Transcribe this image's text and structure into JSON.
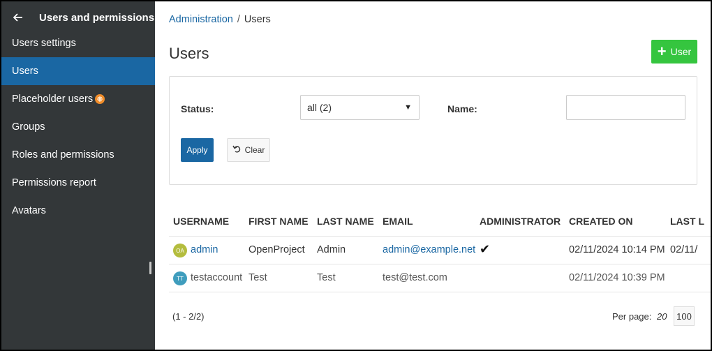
{
  "sidebar": {
    "title": "Users and permissions",
    "items": [
      {
        "label": "Users settings"
      },
      {
        "label": "Users"
      },
      {
        "label": "Placeholder users"
      },
      {
        "label": "Groups"
      },
      {
        "label": "Roles and permissions"
      },
      {
        "label": "Permissions report"
      },
      {
        "label": "Avatars"
      }
    ]
  },
  "breadcrumb": {
    "parent": "Administration",
    "separator": "/",
    "current": "Users"
  },
  "page": {
    "title": "Users",
    "add_button": "User"
  },
  "filters": {
    "status_label": "Status:",
    "status_value": "all (2)",
    "name_label": "Name:",
    "name_value": "",
    "apply": "Apply",
    "clear": "Clear"
  },
  "table": {
    "headers": [
      "USERNAME",
      "FIRST NAME",
      "LAST NAME",
      "EMAIL",
      "ADMINISTRATOR",
      "CREATED ON",
      "LAST L"
    ],
    "rows": [
      {
        "initials": "OA",
        "avatar_color": "#b4bd3e",
        "username": "admin",
        "first": "OpenProject",
        "last": "Admin",
        "email": "admin@example.net",
        "admin": "✔",
        "created": "02/11/2024 10:14 PM",
        "last_login": "02/11/"
      },
      {
        "initials": "TT",
        "avatar_color": "#3f9dbd",
        "username": "testaccount",
        "first": "Test",
        "last": "Test",
        "email": "test@test.com",
        "admin": "",
        "created": "02/11/2024 10:39 PM",
        "last_login": ""
      }
    ]
  },
  "pagination": {
    "info": "(1 - 2/2)",
    "per_page_label": "Per page:",
    "option_20": "20",
    "option_100": "100"
  }
}
